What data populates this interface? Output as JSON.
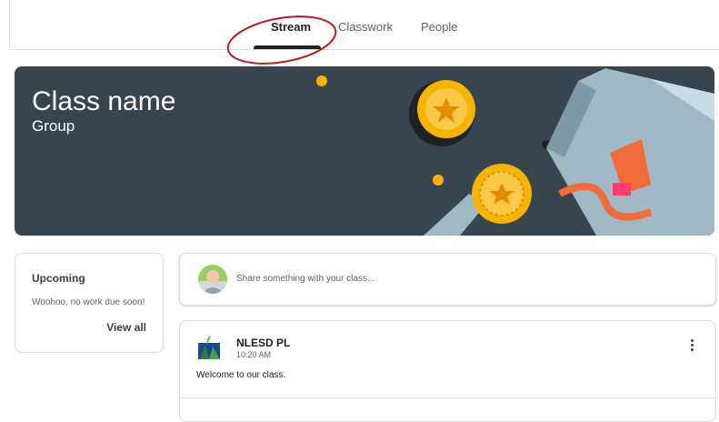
{
  "tabs": [
    {
      "label": "Stream",
      "active": true
    },
    {
      "label": "Classwork",
      "active": false
    },
    {
      "label": "People",
      "active": false
    }
  ],
  "banner": {
    "title": "Class name",
    "subtitle": "Group",
    "background_color": "#38444e"
  },
  "upcoming": {
    "title": "Upcoming",
    "text": "Woohoo, no work due soon!",
    "link": "View all"
  },
  "share": {
    "placeholder": "Share something with your class..."
  },
  "post": {
    "author": "NLESD PL",
    "time": "10:20 AM",
    "body": "Welcome to our class.",
    "menu_icon": "more-vert-icon"
  },
  "colors": {
    "callout": "#b71c1c",
    "gold": "#f4b400"
  }
}
